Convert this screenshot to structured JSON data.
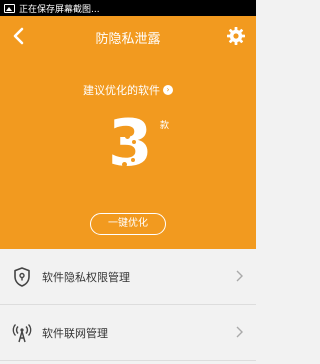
{
  "status_bar": {
    "notification_text": "正在保存屏幕截图..."
  },
  "header": {
    "title": "防隐私泄露"
  },
  "summary": {
    "suggest_label": "建议优化的软件",
    "count": "3",
    "unit": "款",
    "optimize_button": "一键优化"
  },
  "list": {
    "items": [
      {
        "label": "软件隐私权限管理",
        "icon": "shield-icon"
      },
      {
        "label": "软件联网管理",
        "icon": "antenna-icon"
      }
    ]
  },
  "colors": {
    "accent": "#f29a1f",
    "background": "#f2f2f2",
    "text": "#333333"
  }
}
